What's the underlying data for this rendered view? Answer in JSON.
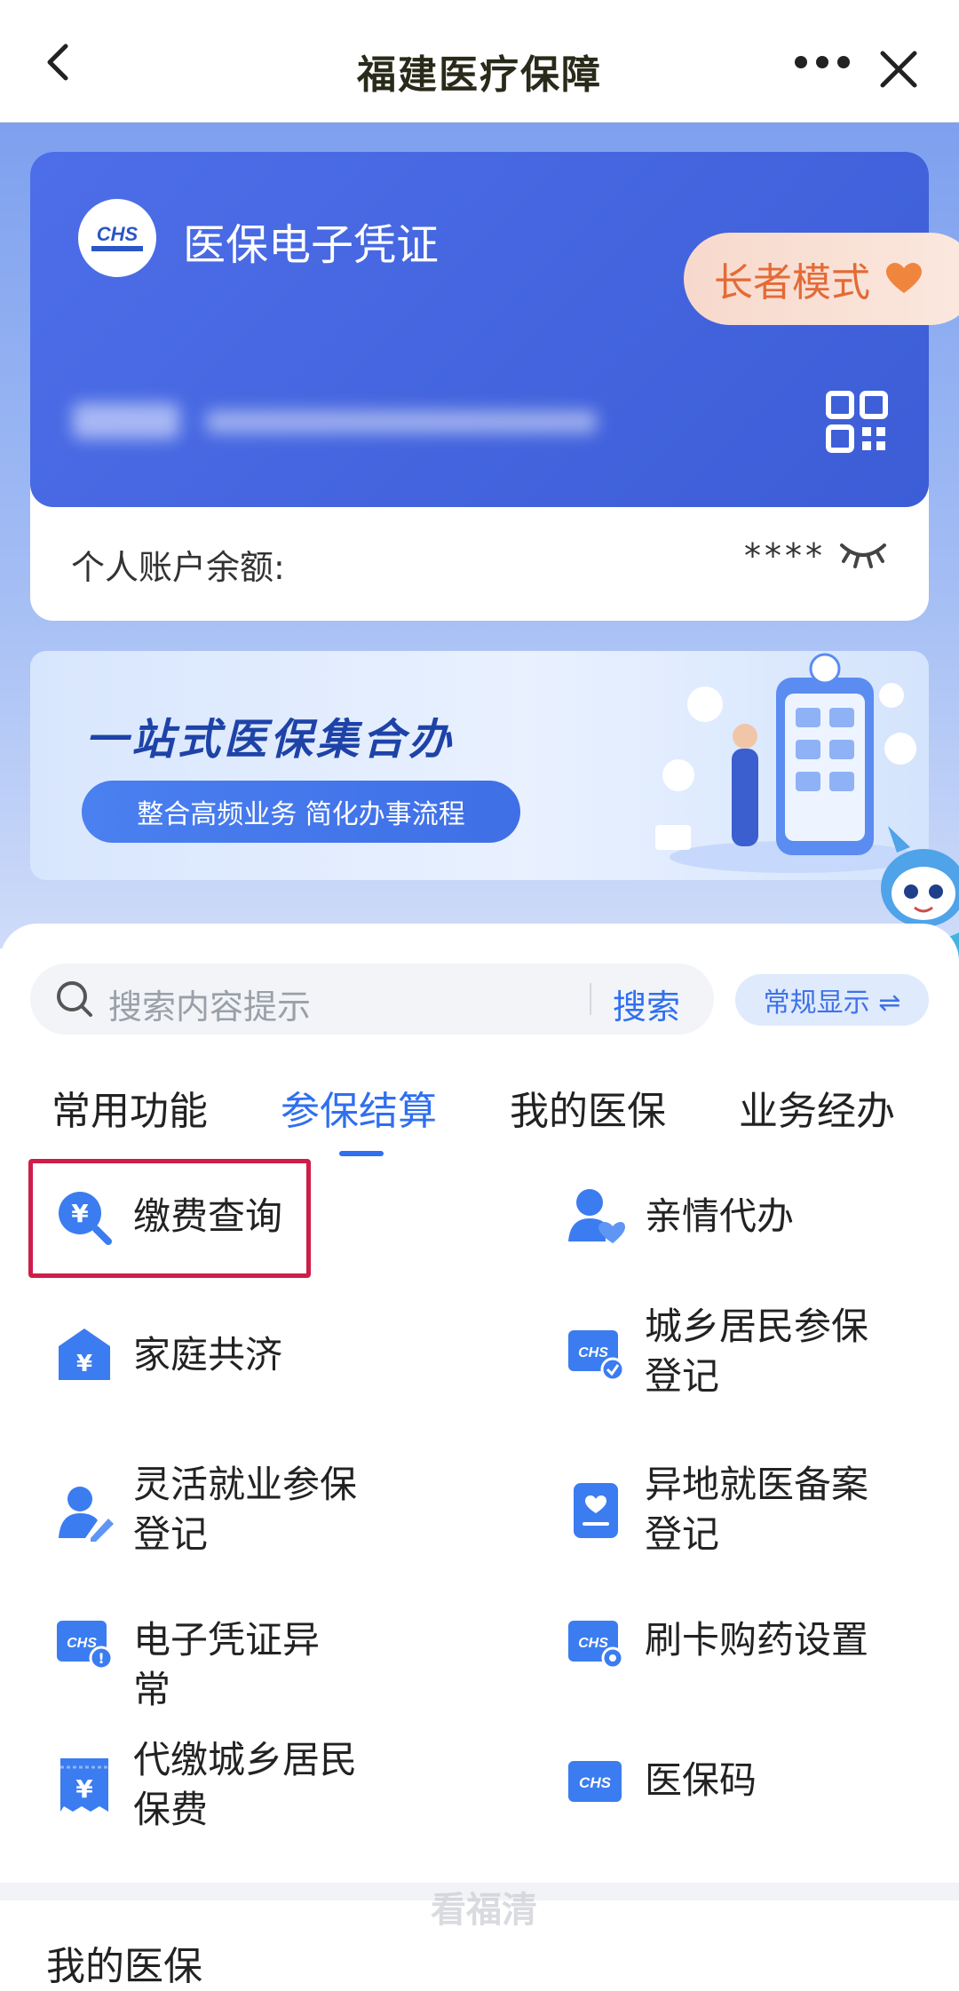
{
  "nav": {
    "title": "福建医疗保障"
  },
  "card": {
    "title": "医保电子凭证",
    "elder_mode": "长者模式",
    "balance_label": "个人账户余额:",
    "balance_value": "****"
  },
  "banner": {
    "headline": "一站式医保集合办",
    "sub": "整合高频业务 简化办事流程"
  },
  "search": {
    "placeholder": "搜索内容提示",
    "button": "搜索",
    "mode_toggle": "常规显示 ⇌"
  },
  "tabs": [
    "常用功能",
    "参保结算",
    "我的医保",
    "业务经办"
  ],
  "active_tab": "参保结算",
  "services": {
    "left": [
      {
        "label": "缴费查询",
        "icon": "payment-search-icon"
      },
      {
        "label": "家庭共济",
        "icon": "family-house-yuan-icon"
      },
      {
        "label": "灵活就业参保\n登记",
        "icon": "person-edit-icon"
      },
      {
        "label": "电子凭证异常",
        "icon": "chs-card-alert-icon"
      },
      {
        "label": "代缴城乡居民\n保费",
        "icon": "bill-yuan-icon"
      }
    ],
    "right": [
      {
        "label": "亲情代办",
        "icon": "person-heart-icon"
      },
      {
        "label": "城乡居民参保\n登记",
        "icon": "chs-card-check-icon"
      },
      {
        "label": "异地就医备案\n登记",
        "icon": "document-heart-icon"
      },
      {
        "label": "刷卡购药设置",
        "icon": "chs-card-gear-icon"
      },
      {
        "label": "医保码",
        "icon": "chs-card-icon"
      }
    ]
  },
  "section_below": {
    "title": "我的医保"
  },
  "watermark": "看福清",
  "colors": {
    "accent": "#2f6ff0",
    "card_blue": "#4466e0",
    "highlight": "#cf1d4a",
    "elder_text": "#e46a36"
  }
}
